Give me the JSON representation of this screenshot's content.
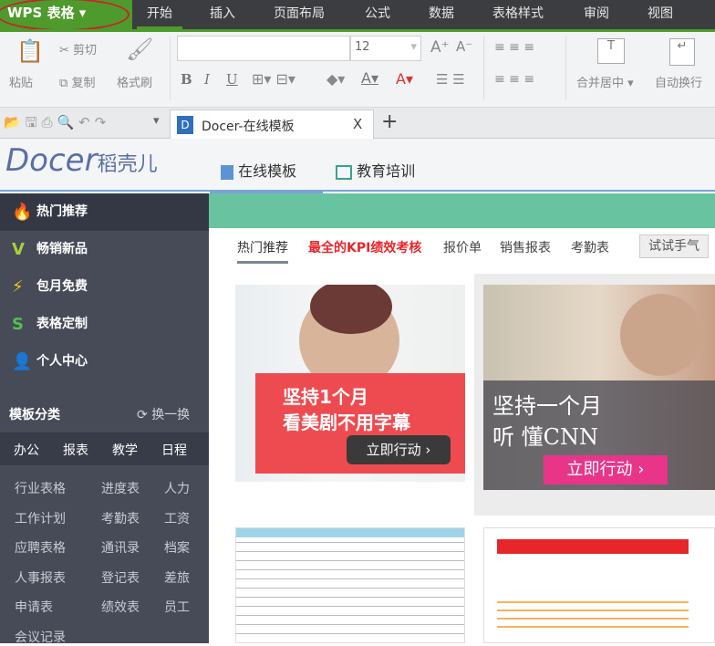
{
  "menubar": {
    "app": "WPS 表格",
    "items": [
      "开始",
      "插入",
      "页面布局",
      "公式",
      "数据",
      "表格样式",
      "审阅",
      "视图"
    ]
  },
  "ribbon": {
    "paste": "粘贴",
    "cut": "剪切",
    "copy": "复制",
    "format_painter": "格式刷",
    "font_name": "",
    "font_size": "12",
    "bold": "B",
    "italic": "I",
    "underline": "U",
    "merge_center": "合并居中",
    "wrap": "自动换行"
  },
  "tabbar": {
    "doc_tab": "Docer-在线模板",
    "close": "X",
    "new": "+"
  },
  "docer": {
    "logo": "Docer稻壳儿",
    "tabs": [
      "在线模板",
      "教育培训"
    ]
  },
  "sidebar": {
    "items": [
      "热门推荐",
      "畅销新品",
      "包月免费",
      "表格定制",
      "个人中心"
    ],
    "category_title": "模板分类",
    "refresh": "换一换",
    "cat_tabs": [
      "办公",
      "报表",
      "教学",
      "日程"
    ],
    "list": [
      [
        "行业表格",
        "进度表",
        "人力"
      ],
      [
        "工作计划",
        "考勤表",
        "工资"
      ],
      [
        "应聘表格",
        "通讯录",
        "档案"
      ],
      [
        "人事报表",
        "登记表",
        "差旅"
      ],
      [
        "申请表",
        "绩效表",
        "员工"
      ],
      [
        "会议记录",
        "",
        ""
      ]
    ]
  },
  "main": {
    "nav": [
      "热门推荐",
      "最全的KPI绩效考核",
      "报价单",
      "销售报表",
      "考勤表"
    ],
    "try_button": "试试手气",
    "banner1": {
      "line1": "坚持1个月",
      "line2": "看美剧不用字幕",
      "cta": "立即行动 ›"
    },
    "banner2": {
      "line1": "坚持一个月",
      "line2": "听 懂CNN",
      "cta": "立即行动 ›"
    }
  },
  "colors": {
    "green": "#4e9a2c",
    "sidebar": "#474b58",
    "teal": "#67c3a0",
    "red": "#e8262a"
  }
}
